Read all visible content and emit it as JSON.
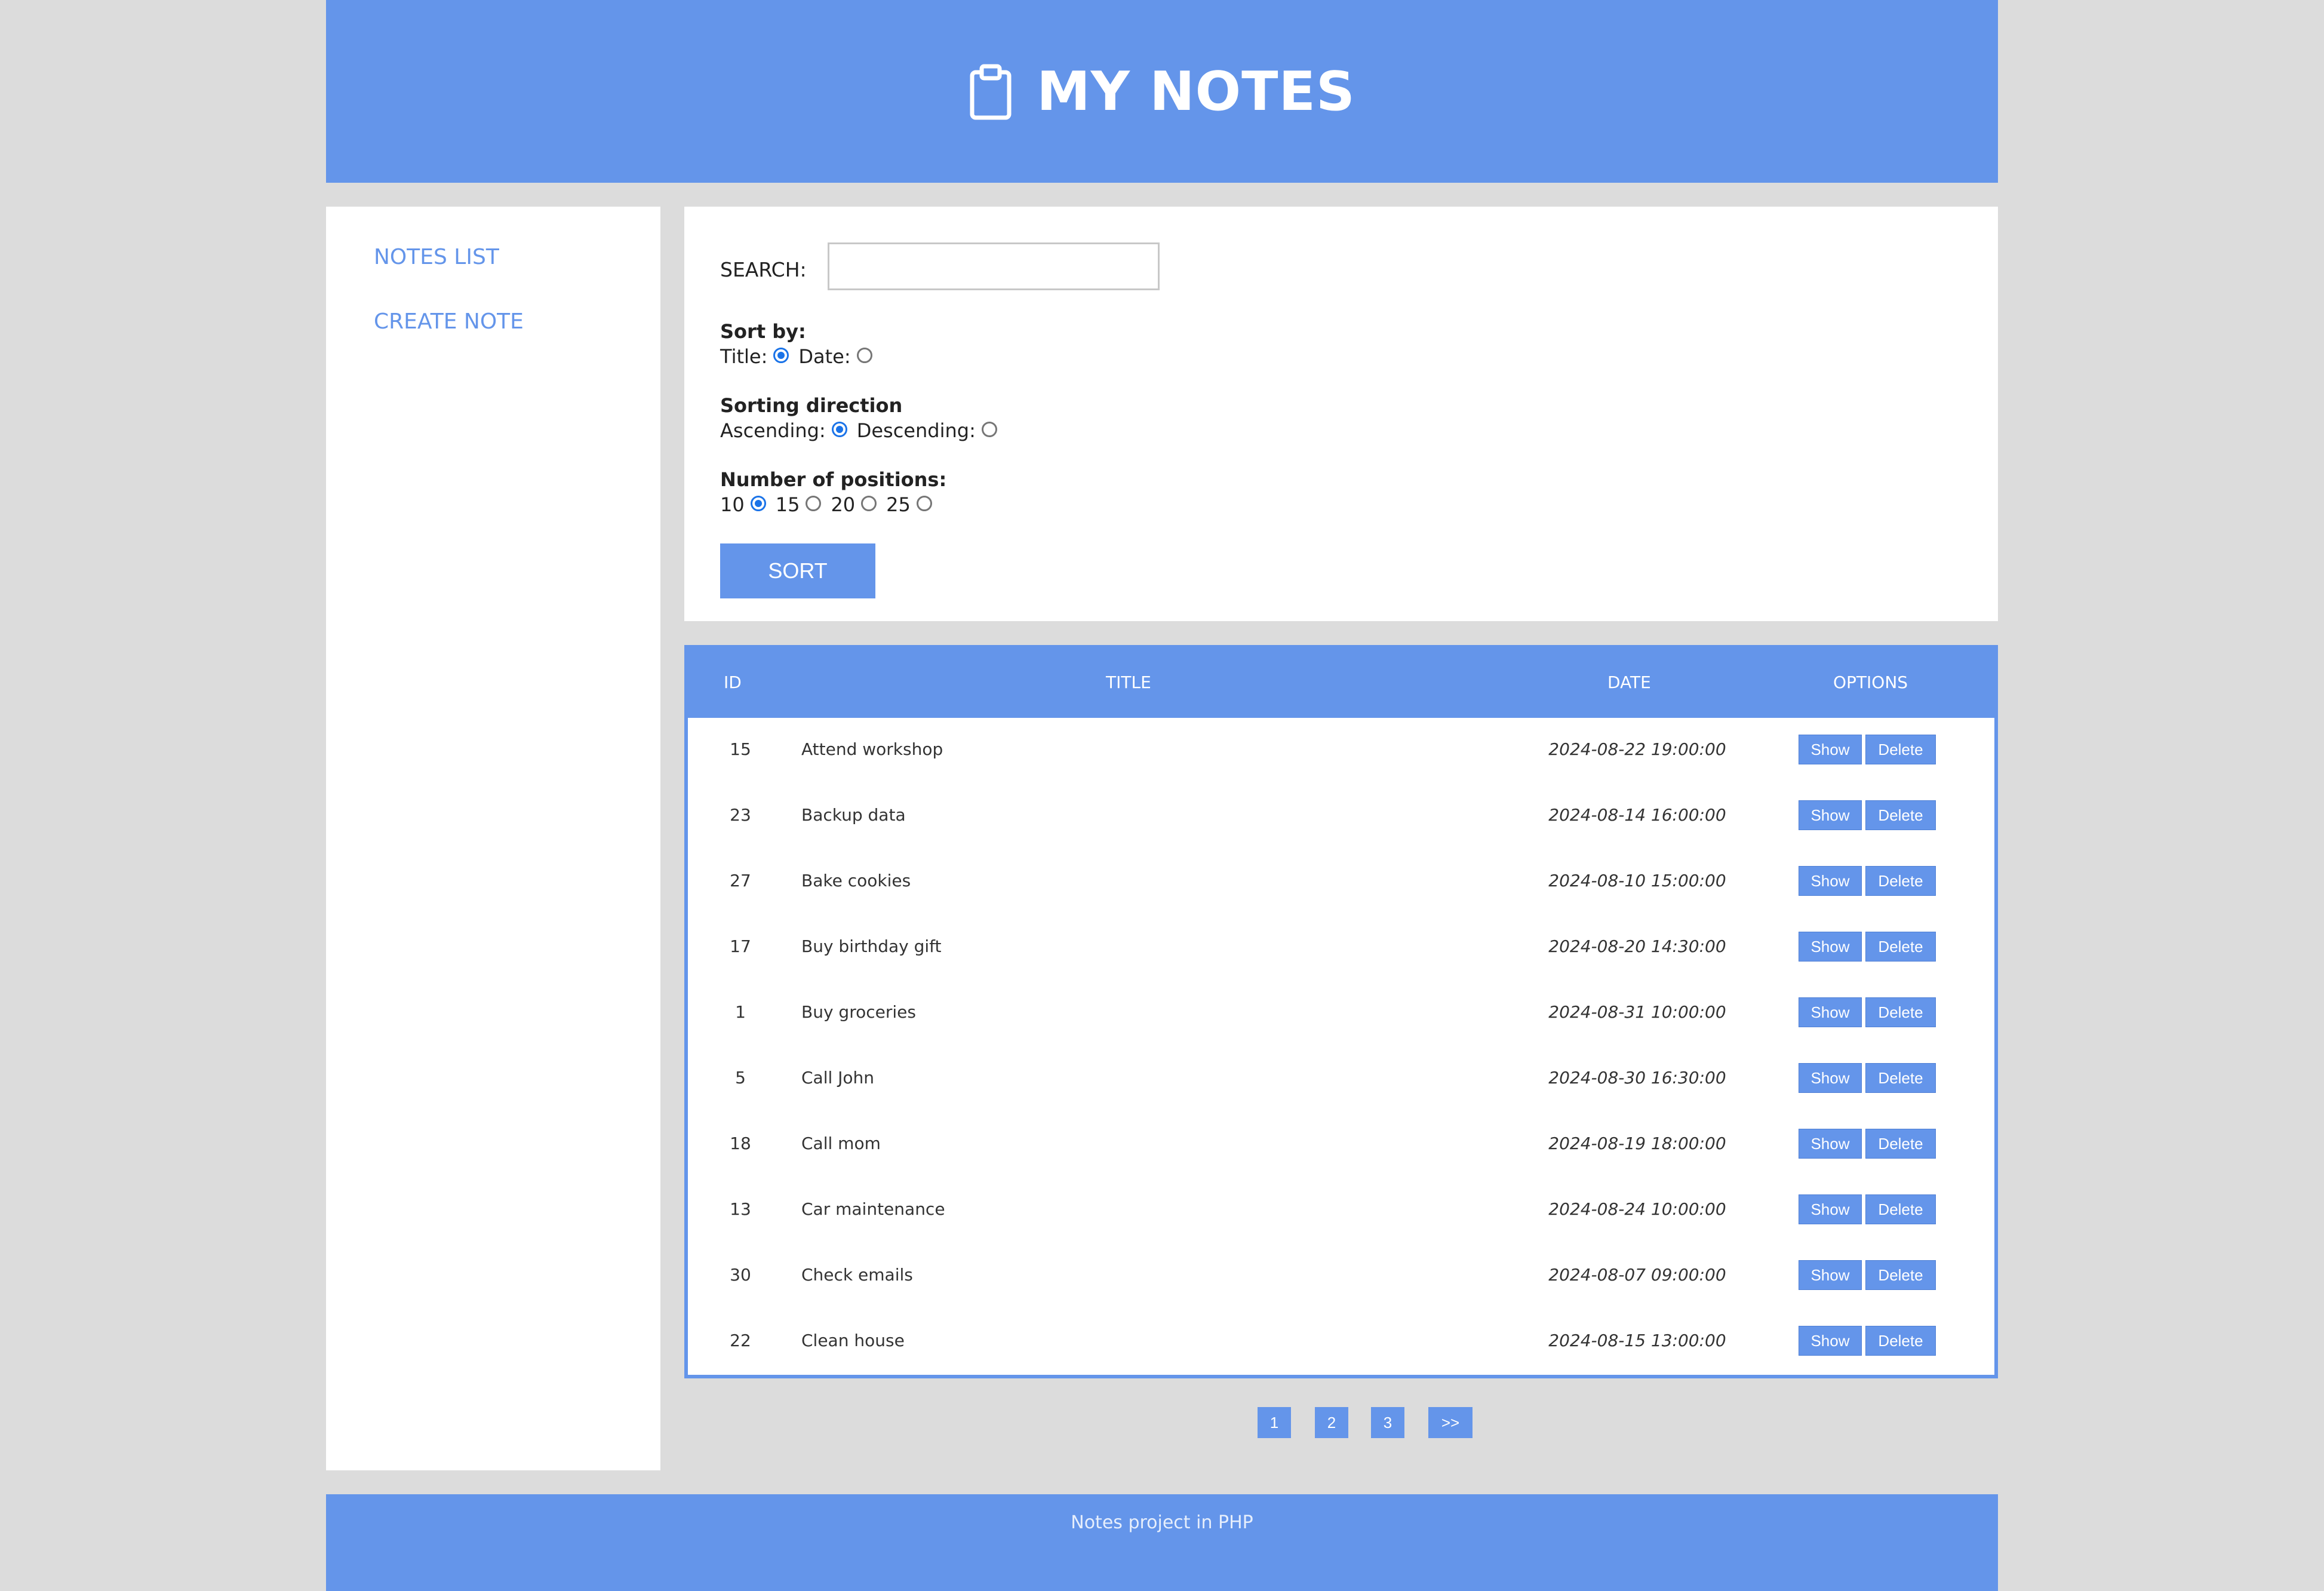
{
  "header": {
    "title": "MY NOTES",
    "icon": "clipboard-icon"
  },
  "sidebar": {
    "items": [
      {
        "label": "NOTES LIST"
      },
      {
        "label": "CREATE NOTE"
      }
    ]
  },
  "filters": {
    "search_label": "SEARCH:",
    "search_value": "",
    "search_placeholder": "",
    "sort_by": {
      "title": "Sort by:",
      "options": [
        "Title:",
        "Date:"
      ],
      "selected": "Title:"
    },
    "direction": {
      "title": "Sorting direction",
      "options": [
        "Ascending:",
        "Descending:"
      ],
      "selected": "Ascending:"
    },
    "positions": {
      "title": "Number of positions:",
      "options": [
        "10",
        "15",
        "20",
        "25"
      ],
      "selected": "10"
    },
    "sort_button": "SORT"
  },
  "table": {
    "headers": {
      "id": "ID",
      "title": "TITLE",
      "date": "DATE",
      "options": "OPTIONS"
    },
    "show_label": "Show",
    "delete_label": "Delete",
    "rows": [
      {
        "id": "15",
        "title": "Attend workshop",
        "date": "2024-08-22 19:00:00"
      },
      {
        "id": "23",
        "title": "Backup data",
        "date": "2024-08-14 16:00:00"
      },
      {
        "id": "27",
        "title": "Bake cookies",
        "date": "2024-08-10 15:00:00"
      },
      {
        "id": "17",
        "title": "Buy birthday gift",
        "date": "2024-08-20 14:30:00"
      },
      {
        "id": "1",
        "title": "Buy groceries",
        "date": "2024-08-31 10:00:00"
      },
      {
        "id": "5",
        "title": "Call John",
        "date": "2024-08-30 16:30:00"
      },
      {
        "id": "18",
        "title": "Call mom",
        "date": "2024-08-19 18:00:00"
      },
      {
        "id": "13",
        "title": "Car maintenance",
        "date": "2024-08-24 10:00:00"
      },
      {
        "id": "30",
        "title": "Check emails",
        "date": "2024-08-07 09:00:00"
      },
      {
        "id": "22",
        "title": "Clean house",
        "date": "2024-08-15 13:00:00"
      }
    ]
  },
  "pagination": {
    "pages": [
      "1",
      "2",
      "3"
    ],
    "next": ">>"
  },
  "footer": {
    "text": "Notes project in PHP"
  },
  "colors": {
    "accent": "#6495ea",
    "background": "#dcdcdc",
    "radio": "#1a73e8"
  }
}
